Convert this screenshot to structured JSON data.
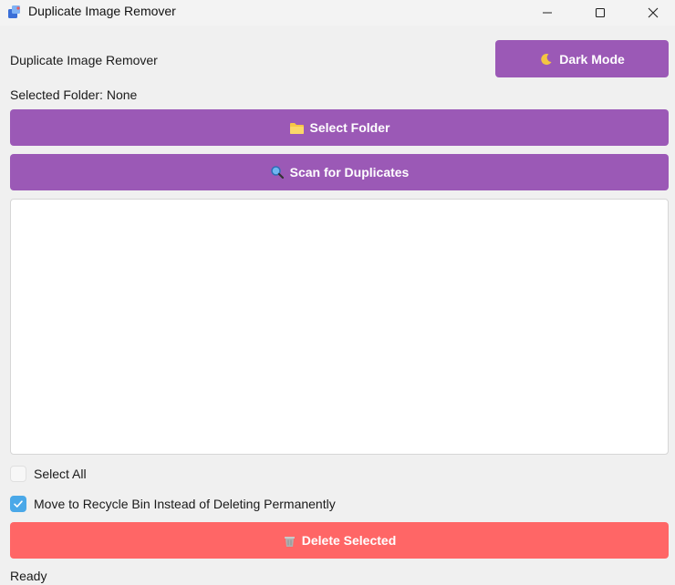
{
  "window": {
    "title": "Duplicate Image Remover",
    "controls": [
      "minimize",
      "maximize",
      "close"
    ]
  },
  "header": {
    "app_label": "Duplicate Image Remover",
    "dark_mode_label": "Dark Mode",
    "dark_mode_icon": "moon-icon"
  },
  "folder": {
    "label": "Selected Folder: None"
  },
  "actions": {
    "select_folder_label": "Select Folder",
    "select_folder_icon": "folder-icon",
    "scan_label": "Scan for Duplicates",
    "scan_icon": "magnifier-icon",
    "delete_label": "Delete Selected",
    "delete_icon": "wastebasket-icon"
  },
  "options": {
    "select_all_label": "Select All",
    "select_all_checked": false,
    "recycle_label": "Move to Recycle Bin Instead of Deleting Permanently",
    "recycle_checked": true
  },
  "status": {
    "text": "Ready"
  },
  "colors": {
    "primary_button": "#9b59b6",
    "danger_button": "#ff6666",
    "checkbox_accent": "#4aa8e8",
    "background": "#f0f0f0"
  }
}
